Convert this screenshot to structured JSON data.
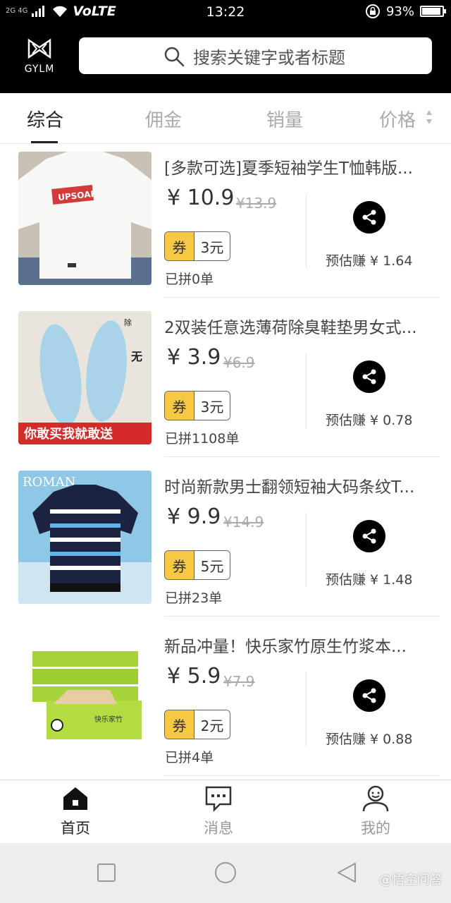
{
  "status_bar": {
    "signal_text": "2G 4G",
    "network": "VoLTE",
    "time": "13:22",
    "battery_percent": "93%",
    "battery_level": 0.93
  },
  "header": {
    "logo_text": "GYLM",
    "search_placeholder": "搜索关键字或者标题"
  },
  "tabs": [
    {
      "label": "综合",
      "active": true
    },
    {
      "label": "佣金",
      "active": false
    },
    {
      "label": "销量",
      "active": false
    },
    {
      "label": "价格",
      "active": false
    }
  ],
  "products": [
    {
      "title": "[多款可选]夏季短袖学生T恤韩版...",
      "price": "¥ 10.9",
      "original_price": "¥13.9",
      "coupon_label": "券",
      "coupon_amount": "3元",
      "sold": "已拼0单",
      "earn": "预估赚 ¥ 1.64",
      "image_text": "UPSOAR"
    },
    {
      "title": "2双装任意选薄荷除臭鞋垫男女式...",
      "price": "¥ 3.9",
      "original_price": "¥6.9",
      "coupon_label": "券",
      "coupon_amount": "3元",
      "sold": "已拼1108单",
      "earn": "预估赚 ¥ 0.78",
      "image_text": "你敢买我就敢送"
    },
    {
      "title": "时尚新款男士翻领短袖大码条纹T...",
      "price": "¥ 9.9",
      "original_price": "¥14.9",
      "coupon_label": "券",
      "coupon_amount": "5元",
      "sold": "已拼23单",
      "earn": "预估赚 ¥ 1.48",
      "image_text": "ROMAN"
    },
    {
      "title": "新品冲量！快乐家竹原生竹浆本...",
      "price": "¥ 5.9",
      "original_price": "¥7.9",
      "coupon_label": "券",
      "coupon_amount": "2元",
      "sold": "已拼4单",
      "earn": "预估赚 ¥ 0.88",
      "image_text": "快乐家竹"
    }
  ],
  "bottom_nav": [
    {
      "label": "首页",
      "icon": "home-icon",
      "active": true
    },
    {
      "label": "消息",
      "icon": "message-icon",
      "active": false
    },
    {
      "label": "我的",
      "icon": "profile-icon",
      "active": false
    }
  ],
  "watermark": "@悟空问答",
  "colors": {
    "header_bg": "#000000",
    "coupon_yellow": "#f7c844",
    "text_dark": "#333333",
    "text_muted": "#aaaaaa"
  }
}
